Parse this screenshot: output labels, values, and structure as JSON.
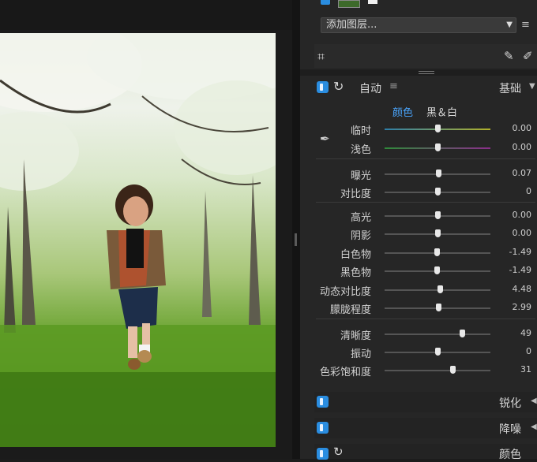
{
  "toolbar": {
    "layer_select_value": "添加图层..."
  },
  "basic_panel": {
    "auto_label": "自动",
    "preset_label": "基础",
    "tabs": {
      "color": "颜色",
      "bw": "黑＆白"
    },
    "sliders": [
      {
        "label": "临时",
        "value": "0.00",
        "pos": 0.5
      },
      {
        "label": "浅色",
        "value": "0.00",
        "pos": 0.5
      },
      {
        "label": "曝光",
        "value": "0.07",
        "pos": 0.505
      },
      {
        "label": "对比度",
        "value": "0",
        "pos": 0.5
      },
      {
        "label": "高光",
        "value": "0.00",
        "pos": 0.5
      },
      {
        "label": "阴影",
        "value": "0.00",
        "pos": 0.5
      },
      {
        "label": "白色物",
        "value": "-1.49",
        "pos": 0.49
      },
      {
        "label": "黑色物",
        "value": "-1.49",
        "pos": 0.49
      },
      {
        "label": "动态对比度",
        "value": "4.48",
        "pos": 0.52
      },
      {
        "label": "朦胧程度",
        "value": "2.99",
        "pos": 0.51
      },
      {
        "label": "清晰度",
        "value": "49",
        "pos": 0.73
      },
      {
        "label": "振动",
        "value": "0",
        "pos": 0.5
      },
      {
        "label": "色彩饱和度",
        "value": "31",
        "pos": 0.645
      }
    ]
  },
  "sections": {
    "sharpen": "锐化",
    "denoise": "降噪",
    "color": "颜色"
  },
  "colors": {
    "accent": "#2a8de0",
    "panel_bg": "#262626"
  }
}
